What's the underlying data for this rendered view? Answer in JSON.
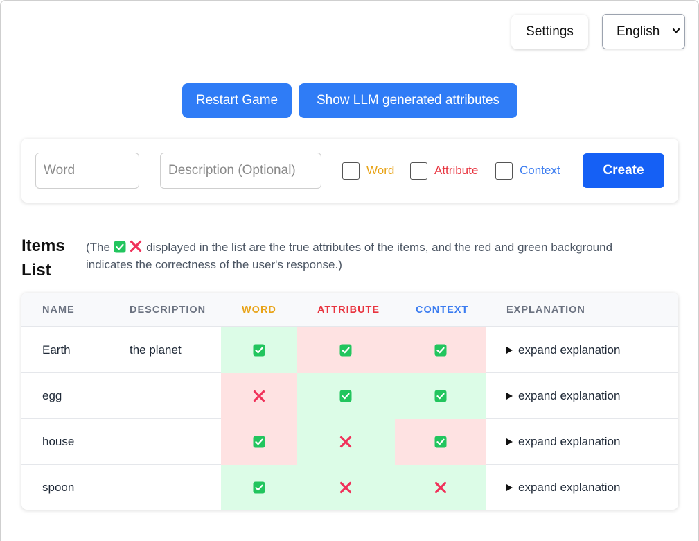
{
  "header": {
    "settings_label": "Settings",
    "language_selected": "English"
  },
  "actions": {
    "restart_label": "Restart Game",
    "llm_label": "Show LLM generated attributes"
  },
  "create_form": {
    "word_placeholder": "Word",
    "description_placeholder": "Description (Optional)",
    "checkbox_word_label": "Word",
    "checkbox_attribute_label": "Attribute",
    "checkbox_context_label": "Context",
    "create_label": "Create"
  },
  "items_list": {
    "title": "Items List",
    "note_prefix": "(The",
    "note_suffix": "displayed in the list are the true attributes of the items, and the red and green background indicates the correctness of the user's response.)"
  },
  "table": {
    "headers": {
      "name": "NAME",
      "description": "DESCRIPTION",
      "word": "WORD",
      "attribute": "ATTRIBUTE",
      "context": "CONTEXT",
      "explanation": "EXPLANATION"
    },
    "rows": [
      {
        "name": "Earth",
        "description": "the planet",
        "word": true,
        "attribute": true,
        "context": true,
        "word_correct": true,
        "attribute_correct": false,
        "context_correct": false,
        "explanation": "expand explanation"
      },
      {
        "name": "egg",
        "description": "",
        "word": false,
        "attribute": true,
        "context": true,
        "word_correct": false,
        "attribute_correct": true,
        "context_correct": true,
        "explanation": "expand explanation"
      },
      {
        "name": "house",
        "description": "",
        "word": true,
        "attribute": false,
        "context": true,
        "word_correct": false,
        "attribute_correct": true,
        "context_correct": false,
        "explanation": "expand explanation"
      },
      {
        "name": "spoon",
        "description": "",
        "word": true,
        "attribute": false,
        "context": false,
        "word_correct": true,
        "attribute_correct": true,
        "context_correct": true,
        "explanation": "expand explanation"
      }
    ]
  },
  "colors": {
    "primary_blue": "#2f7cf6",
    "create_blue": "#1560f5",
    "word_color": "#e8a317",
    "attribute_color": "#e8343f",
    "context_color": "#3b7cf0",
    "correct_bg": "#dcfce7",
    "incorrect_bg": "#fee2e2",
    "check_green": "#22c55e",
    "cross_red": "#f0315a"
  },
  "icons": {
    "true_icon": "check-box-icon",
    "false_icon": "cross-icon",
    "expand_icon": "triangle-right-icon",
    "select_icon": "chevron-down-icon"
  }
}
